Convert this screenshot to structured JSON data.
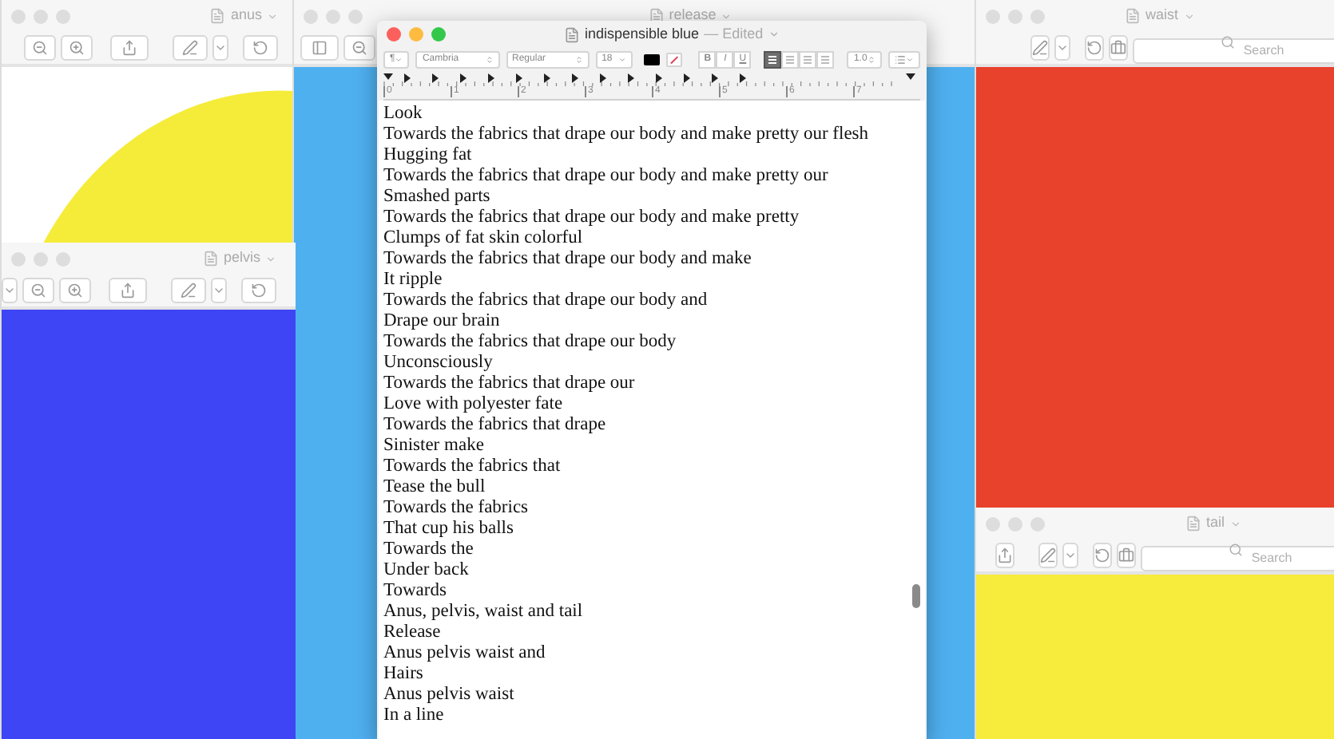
{
  "background_windows": [
    {
      "title": "anus",
      "active": false,
      "content": {
        "kind": "circle",
        "color": "#f5ec3a"
      },
      "tools": [
        {
          "kind": "zoom-out"
        },
        {
          "kind": "zoom-in"
        },
        {
          "kind": "share"
        },
        {
          "kind": "pen"
        },
        {
          "kind": "caret"
        },
        {
          "kind": "rotate"
        }
      ]
    },
    {
      "title": "release",
      "active": false,
      "content": {
        "kind": "fill",
        "color": "#4fb0f0"
      },
      "tools": [
        {
          "kind": "sidebar"
        },
        {
          "kind": "zoom-out"
        }
      ]
    },
    {
      "title": "waist",
      "active": false,
      "content": {
        "kind": "fill",
        "color": "#e8412c"
      },
      "tools": [
        {
          "kind": "pen"
        },
        {
          "kind": "caret"
        },
        {
          "kind": "rotate"
        },
        {
          "kind": "toolbox"
        },
        {
          "kind": "search",
          "placeholder": "Search"
        }
      ]
    },
    {
      "title": "pelvis",
      "active": false,
      "content": {
        "kind": "fill",
        "color": "#3d45f5"
      },
      "tools": [
        {
          "kind": "caret"
        },
        {
          "kind": "zoom-out"
        },
        {
          "kind": "zoom-in"
        },
        {
          "kind": "share"
        },
        {
          "kind": "pen"
        },
        {
          "kind": "caret"
        },
        {
          "kind": "rotate"
        }
      ]
    },
    {
      "title": "tail",
      "active": false,
      "content": {
        "kind": "fill",
        "color": "#f7ec3c"
      },
      "tools": [
        {
          "kind": "share"
        },
        {
          "kind": "pen"
        },
        {
          "kind": "caret"
        },
        {
          "kind": "rotate"
        },
        {
          "kind": "toolbox"
        },
        {
          "kind": "search",
          "placeholder": "Search"
        }
      ]
    }
  ],
  "editor": {
    "title": "indispensible blue",
    "status": "— Edited",
    "toolbar": {
      "paragraph": "¶",
      "font": "Cambria",
      "style": "Regular",
      "size": "18",
      "styles": [
        "B",
        "I",
        "U"
      ],
      "alignment": [
        {
          "selected": true
        },
        {
          "selected": false
        },
        {
          "selected": false
        },
        {
          "selected": false
        }
      ],
      "spacing": "1.0"
    },
    "ruler": [
      "0",
      "1",
      "2",
      "3",
      "4",
      "5",
      "6",
      "7"
    ],
    "lines": [
      "Look",
      "Towards the fabrics that drape our body and make pretty our flesh",
      "Hugging fat",
      "Towards the fabrics that drape our body and make pretty our",
      "Smashed parts",
      "Towards the fabrics that drape our body and make pretty",
      "Clumps of fat skin colorful",
      "Towards the fabrics that drape our body and make",
      "It ripple",
      "Towards the fabrics that drape our body and",
      "Drape our brain",
      "Towards the fabrics that drape our body",
      "Unconsciously",
      "Towards the fabrics that drape our",
      "Love with polyester fate",
      "Towards the fabrics that drape",
      "Sinister make",
      "Towards the fabrics that",
      "Tease the bull",
      "Towards the fabrics",
      "That cup his balls",
      "Towards the",
      "Under back",
      "Towards",
      "Anus, pelvis, waist and tail",
      "Release",
      "Anus pelvis waist and",
      "Hairs",
      "Anus pelvis waist",
      "In a line"
    ]
  }
}
